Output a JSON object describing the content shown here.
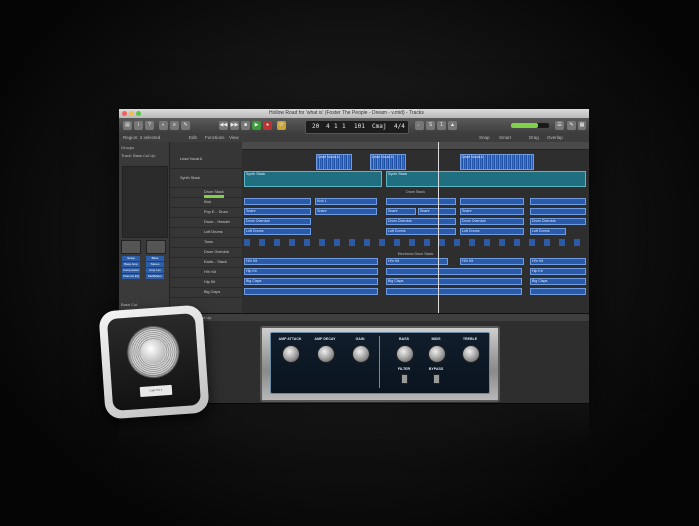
{
  "window": {
    "title": "Hollow Road for 'what is' (Foster The People - Dream - v.mid) - Tracks",
    "lcd": {
      "bar": "20",
      "beat": "4",
      "div": "1",
      "tick": "1",
      "tempo": "101",
      "key": "Cmaj",
      "sig": "4/4"
    },
    "toolbar": {
      "snap_label": "Snap",
      "snap_value": "Smart",
      "drag_label": "Drag",
      "drag_value": "Overlap"
    }
  },
  "menubar": {
    "region": "Region: 2 selected",
    "items": [
      "Edit",
      "Functions",
      "View"
    ]
  },
  "inspector": {
    "groups_label": "Groups",
    "track_label": "Track: Bass Cut Up",
    "buttons": [
      "Setup",
      "Bass Amp",
      "Compressor",
      "Channel EQ",
      "Bass",
      "Stereo",
      "Amp Lev",
      "MultiMeter"
    ],
    "footer": "Bass Cut"
  },
  "tracks": [
    {
      "name": "Lead Vocal A"
    },
    {
      "name": "Synth Stack"
    },
    {
      "name": "Drum Stack"
    },
    {
      "name": "Kick"
    },
    {
      "name": "Pop E... Drum"
    },
    {
      "name": "Drum... Header"
    },
    {
      "name": "Loft Drums"
    },
    {
      "name": "Toms"
    },
    {
      "name": "Drum Overdub"
    },
    {
      "name": "Earth... Stack"
    },
    {
      "name": "Hi'n Kit"
    },
    {
      "name": "Hip Kit"
    },
    {
      "name": "Big Claps"
    }
  ],
  "regions": {
    "lead_vocal": "Lead Vocal A",
    "synth_stack_1": "Synth Stack",
    "synth_stack_2": "Synth Stack",
    "drum_stack": "Drum Stack",
    "electronic": "Electronic Drum Stack",
    "snare": "Snare",
    "kick": "Kick 1",
    "drum_overdub": "Drum Overdub",
    "loft_drums": "Loft Drums",
    "hi_kit": "Hi'n Kit",
    "hip_kit": "Hip Kit",
    "big_claps": "Big Claps"
  },
  "editor": {
    "header": "Bass Cut Up",
    "plugin_knobs": [
      "AMP ATTACK",
      "AMP DECAY",
      "GAIN",
      "BASS",
      "MIDS",
      "TREBLE"
    ],
    "switches": [
      "FILTER",
      "BYPASS"
    ]
  },
  "app_icon": {
    "label": "Logic Pro X"
  }
}
